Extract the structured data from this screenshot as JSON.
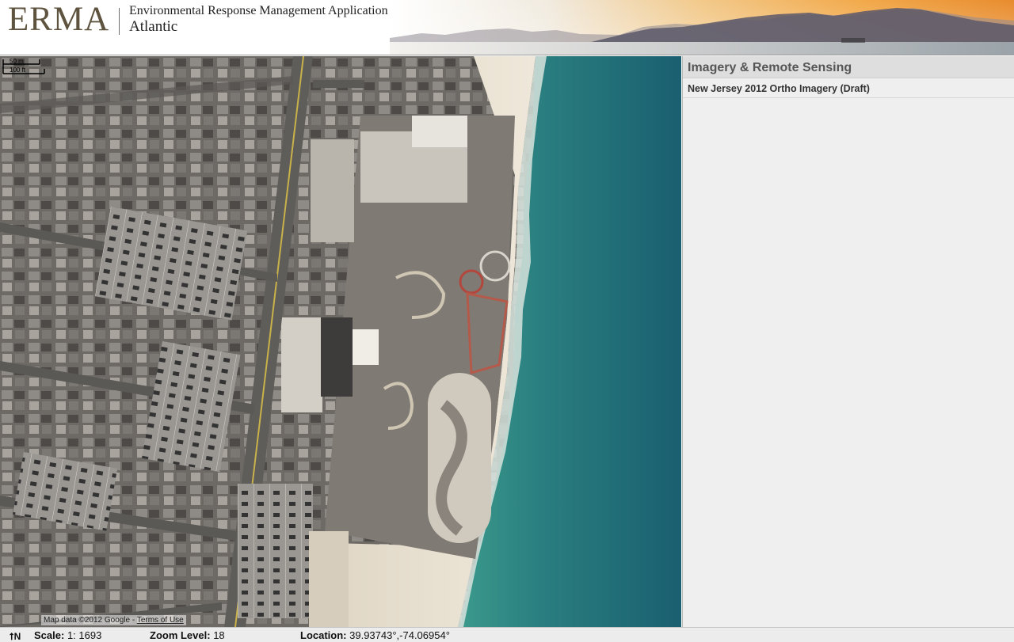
{
  "header": {
    "logo_text": "ERMA",
    "app_title": "Environmental Response Management Application",
    "region": "Atlantic"
  },
  "map": {
    "scale_bar_top": "50 m",
    "scale_bar_bottom": "100 ft",
    "attribution": "Map data ©2012 Google - ",
    "terms_link": "Terms of Use"
  },
  "panel": {
    "title": "Imagery & Remote Sensing",
    "layers": [
      "New Jersey 2012 Ortho Imagery (Draft)"
    ]
  },
  "status": {
    "north_icon": "north-arrow-icon",
    "north_label": "N",
    "scale_label": "Scale:",
    "scale_value": "1: 1693",
    "zoom_label": "Zoom Level:",
    "zoom_value": "18",
    "location_label": "Location:",
    "location_value": "39.93743°,-74.06954°"
  },
  "colors": {
    "ocean": "#1f6f78",
    "beach": "#e9e1d2",
    "header_divider": "#9a9a9a",
    "panel_bg": "#efefef"
  }
}
